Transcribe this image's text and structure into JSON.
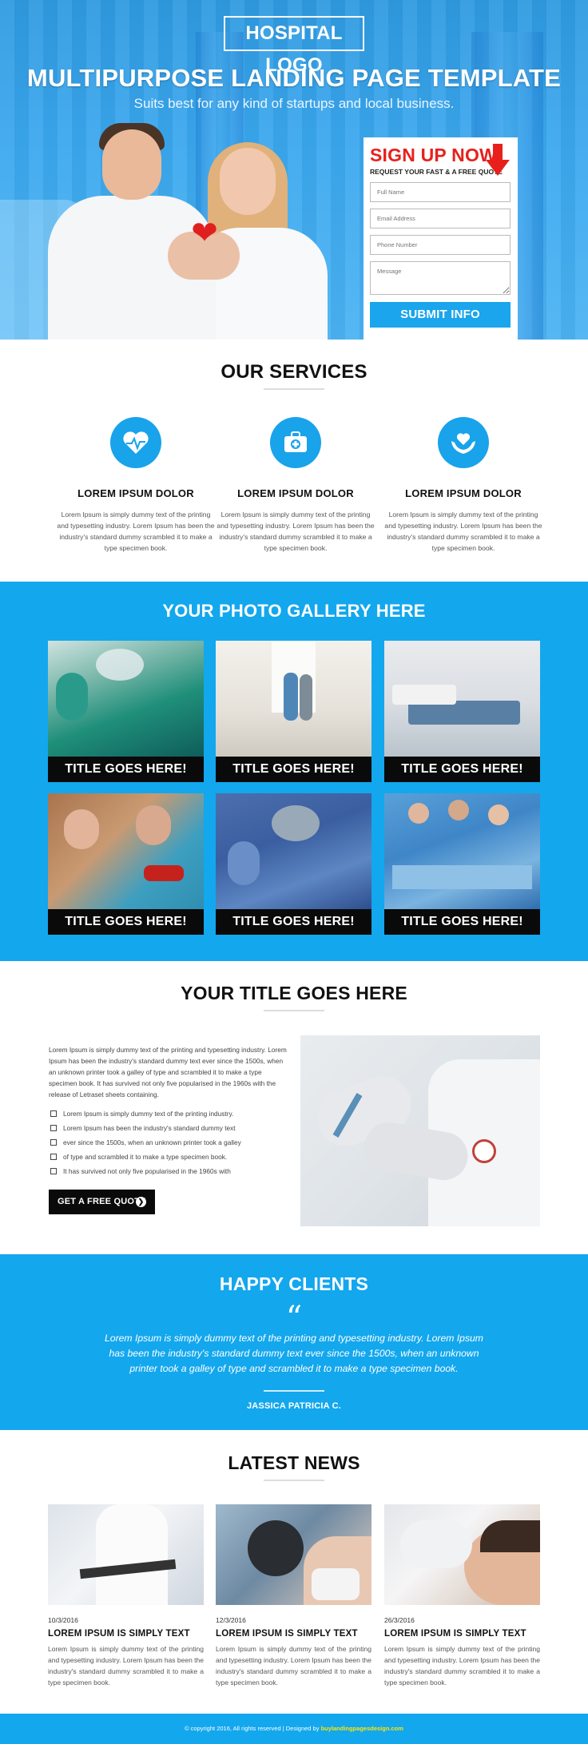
{
  "hero": {
    "logo": "HOSPITAL LOGO",
    "title": "MULTIPURPOSE LANDING PAGE TEMPLATE",
    "subtitle": "Suits best for any kind of startups and local business."
  },
  "signup": {
    "title": "SIGN UP NOW",
    "subtitle": "REQUEST YOUR FAST & A FREE QUOTE",
    "fields": {
      "full_name": "Full Name",
      "email": "Email Address",
      "phone": "Phone Number",
      "message": "Message"
    },
    "submit_label": "SUBMIT INFO"
  },
  "services": {
    "title": "OUR SERVICES",
    "items": [
      {
        "name": "LOREM IPSUM DOLOR",
        "text": "Lorem Ipsum is simply dummy text of the printing and typesetting industry. Lorem Ipsum has been the industry's standard dummy scrambled it to make a type specimen book.",
        "icon": "heartbeat-icon"
      },
      {
        "name": "LOREM IPSUM DOLOR",
        "text": "Lorem Ipsum is simply dummy text of the printing and typesetting industry. Lorem Ipsum has been the industry's standard dummy scrambled it to make a type specimen book.",
        "icon": "medical-kit-icon"
      },
      {
        "name": "LOREM IPSUM DOLOR",
        "text": "Lorem Ipsum is simply dummy text of the printing and typesetting industry. Lorem Ipsum has been the industry's standard dummy scrambled it to make a type specimen book.",
        "icon": "heart-hands-icon"
      }
    ]
  },
  "gallery": {
    "title": "YOUR PHOTO GALLERY HERE",
    "items": [
      {
        "caption": "TITLE GOES HERE!"
      },
      {
        "caption": "TITLE GOES HERE!"
      },
      {
        "caption": "TITLE GOES HERE!"
      },
      {
        "caption": "TITLE GOES HERE!"
      },
      {
        "caption": "TITLE GOES HERE!"
      },
      {
        "caption": "TITLE GOES HERE!"
      }
    ]
  },
  "about": {
    "title": "YOUR TITLE GOES HERE",
    "text": "Lorem Ipsum is simply dummy text of the printing and typesetting industry. Lorem Ipsum has been the industry's standard dummy text ever since the 1500s, when an unknown printer took a galley of type and scrambled it to make a type specimen book. It has survived not only five  popularised in the 1960s with the release of Letraset sheets containing.",
    "list": [
      "Lorem Ipsum is simply dummy text of the printing industry.",
      "Lorem Ipsum has been the industry's standard dummy text",
      "ever since the 1500s, when an unknown printer took a galley",
      "of type and scrambled it to make a type specimen book.",
      "It has survived not only five  popularised in the 1960s with"
    ],
    "button_label": "GET A FREE QUOTE"
  },
  "clients": {
    "title": "HAPPY CLIENTS",
    "quote_mark": "“",
    "text": "Lorem Ipsum is simply dummy text of the printing and typesetting industry. Lorem Ipsum has been the industry's standard dummy text ever since the 1500s, when an unknown printer took a galley of type and scrambled it to make a type specimen book.",
    "name": "JASSICA PATRICIA C."
  },
  "news": {
    "title": "LATEST NEWS",
    "items": [
      {
        "date": "10/3/2016",
        "heading": "LOREM IPSUM IS SIMPLY TEXT",
        "text": "Lorem Ipsum is simply dummy text of the printing and typesetting industry. Lorem Ipsum has been the industry's standard dummy scrambled it to make a type specimen book."
      },
      {
        "date": "12/3/2016",
        "heading": "LOREM IPSUM IS SIMPLY TEXT",
        "text": "Lorem Ipsum is simply dummy text of the printing and typesetting industry. Lorem Ipsum has been the industry's standard dummy scrambled it to make a type specimen book."
      },
      {
        "date": "26/3/2016",
        "heading": "LOREM IPSUM IS SIMPLY TEXT",
        "text": "Lorem Ipsum is simply dummy text of the printing and typesetting industry. Lorem Ipsum has been the industry's standard dummy scrambled it to make a type specimen book."
      }
    ]
  },
  "footer": {
    "text": "© copyright 2016, All rights reserved | Designed by",
    "link": "buylandingpagesdesign.com"
  },
  "colors": {
    "accent_blue": "#13a7ee",
    "signup_red": "#e8201c",
    "footer_link": "#ffe400",
    "dark": "#0a0a0a"
  }
}
